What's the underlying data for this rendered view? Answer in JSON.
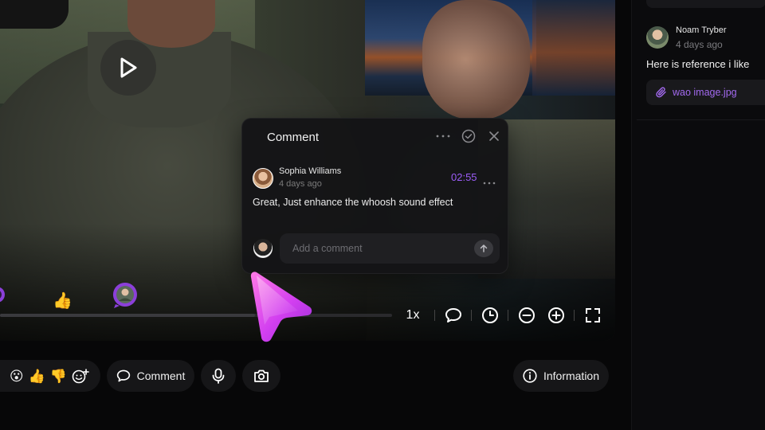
{
  "video": {
    "play_icon": "play-icon"
  },
  "comment_popup": {
    "title": "Comment",
    "icons": [
      "more-icon",
      "check-circle-icon",
      "close-icon"
    ],
    "comment": {
      "author": "Sophia Williams",
      "time_ago": "4 days ago",
      "timestamp": "02:55",
      "text": "Great, Just enhance the whoosh sound effect"
    },
    "input": {
      "placeholder": "Add a comment",
      "value": ""
    },
    "send_icon": "arrow-up-icon"
  },
  "timeline": {
    "markers": [
      "comment-marker",
      "thumbs-up-reaction",
      "avatar-comment-marker"
    ],
    "marker_thumb": "👍"
  },
  "controls": {
    "speed": "1x",
    "icons": [
      "comment-icon",
      "clock-icon",
      "zoom-out-icon",
      "zoom-in-icon",
      "fullscreen-icon"
    ]
  },
  "bottom_bar": {
    "emojis": [
      "😮",
      "👍",
      "👎"
    ],
    "comment_label": "Comment",
    "information_label": "Information"
  },
  "side_panel": {
    "author": "Noam Tryber",
    "time_ago": "4 days ago",
    "text": "Here is reference i like",
    "attachment": "wao image.jpg"
  },
  "colors": {
    "accent": "#9b5cf6",
    "background": "#070708",
    "surface": "#161618"
  }
}
